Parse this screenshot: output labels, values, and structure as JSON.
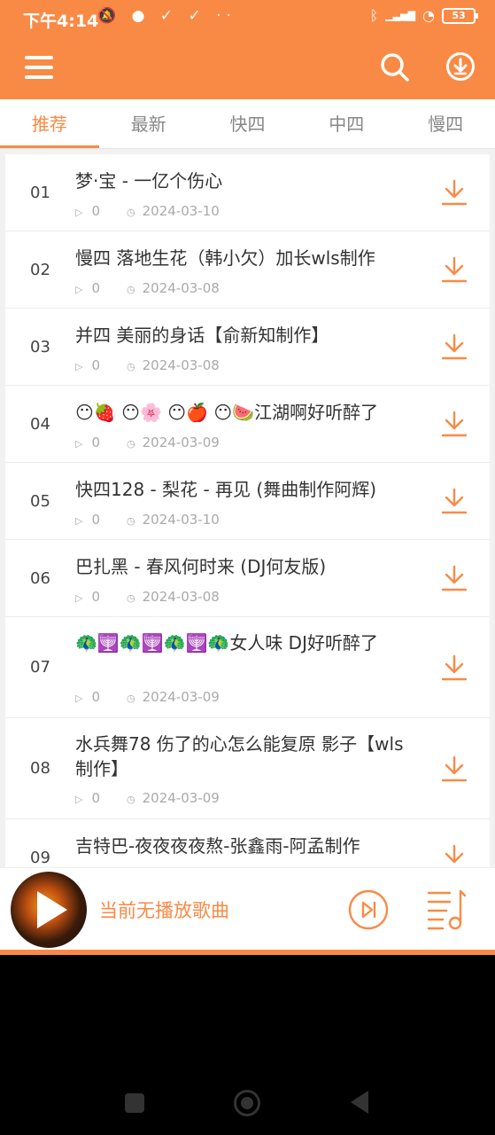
{
  "status_bar": {
    "time": "下午4:14",
    "left_icons": [
      "mute-icon",
      "chat-icon",
      "check-icon",
      "check-icon",
      "dots-icon"
    ],
    "left_glyphs": "🔕 ● ✓ ✓ ··",
    "right_icons": [
      "bluetooth-icon",
      "signal-icon",
      "wifi-icon",
      "battery-icon"
    ],
    "bt_glyph": "ᛒ",
    "signal_glyph": "▁▃▅▇",
    "wifi_glyph": "◔",
    "battery": "53"
  },
  "colors": {
    "accent": "#F98A45",
    "text": "#333333",
    "muted": "#AAAAAA"
  },
  "toolbar": {
    "menu_icon": "menu-icon",
    "search_icon": "search-icon",
    "download_icon": "download-circle-icon"
  },
  "tabs": [
    {
      "label": "推荐",
      "active": true
    },
    {
      "label": "最新",
      "active": false
    },
    {
      "label": "快四",
      "active": false
    },
    {
      "label": "中四",
      "active": false
    },
    {
      "label": "慢四",
      "active": false
    }
  ],
  "songs": [
    {
      "index": "01",
      "title": "梦·宝 - 一亿个伤心",
      "plays": "0",
      "date": "2024-03-10"
    },
    {
      "index": "02",
      "title": "慢四 落地生花（韩小欠）加长wls制作",
      "plays": "0",
      "date": "2024-03-08"
    },
    {
      "index": "03",
      "title": "并四  美丽的身话【俞新知制作】",
      "plays": "0",
      "date": "2024-03-08"
    },
    {
      "index": "04",
      "title": "😶🍓 😶🌸 😶🍎 😶🍉江湖啊好听醉了",
      "plays": "0",
      "date": "2024-03-09"
    },
    {
      "index": "05",
      "title": "快四128 - 梨花 - 再见 (舞曲制作阿辉)",
      "plays": "0",
      "date": "2024-03-10"
    },
    {
      "index": "06",
      "title": "巴扎黑 - 春风何时来 (DJ何友版)",
      "plays": "0",
      "date": "2024-03-08"
    },
    {
      "index": "07",
      "title": "🦚🕎🦚🕎🦚🕎🦚女人味 DJ好听醉了",
      "plays": "0",
      "date": "2024-03-09"
    },
    {
      "index": "08",
      "title": "水兵舞78  伤了的心怎么能复原  影子【wls制作】",
      "plays": "0",
      "date": "2024-03-09"
    },
    {
      "index": "09",
      "title": "吉特巴-夜夜夜夜熬-张鑫雨-阿孟制作",
      "plays": "",
      "date": ""
    }
  ],
  "player": {
    "now_playing": "当前无播放歌曲"
  }
}
